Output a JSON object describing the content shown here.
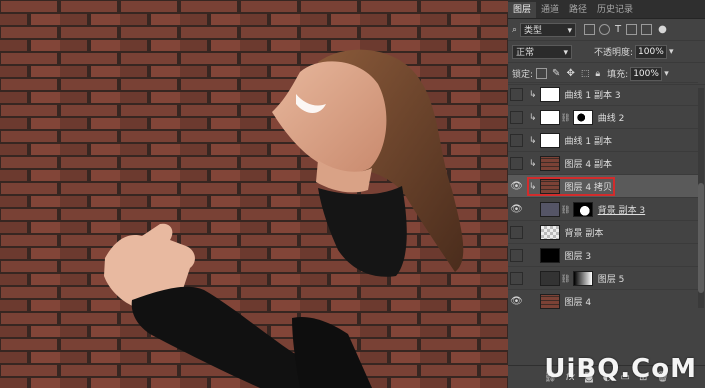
{
  "panel": {
    "tabs": [
      "图层",
      "通道",
      "路径",
      "历史记录"
    ],
    "active_tab": 0,
    "filter_select": "类型",
    "blend_mode": "正常",
    "opacity_label": "不透明度:",
    "opacity_value": "100%",
    "lock_label": "锁定:",
    "fill_label": "填充:",
    "fill_value": "100%",
    "layers": [
      {
        "name": "曲线 1 副本 3",
        "visible": false,
        "clipped": true,
        "thumb": "checker-white"
      },
      {
        "name": "曲线 2",
        "visible": false,
        "clipped": true,
        "thumb": "adjust-mask"
      },
      {
        "name": "曲线 1 副本",
        "visible": false,
        "clipped": true,
        "thumb": "checker-white"
      },
      {
        "name": "图层 4 副本",
        "visible": false,
        "clipped": true,
        "thumb": "brick"
      },
      {
        "name": "图层 4 拷贝",
        "visible": true,
        "clipped": true,
        "thumb": "brick",
        "selected": true
      },
      {
        "name": "背景 副本 3",
        "visible": true,
        "clipped": false,
        "thumb": "photo-mask"
      },
      {
        "name": "背景 副本",
        "visible": false,
        "clipped": false,
        "thumb": "checker"
      },
      {
        "name": "图层 3",
        "visible": false,
        "clipped": false,
        "thumb": "black"
      },
      {
        "name": "图层 5",
        "visible": false,
        "clipped": false,
        "thumb": "photo-gradient"
      },
      {
        "name": "图层 4",
        "visible": true,
        "clipped": false,
        "thumb": "brick"
      }
    ],
    "bottom_icons": [
      "link-icon",
      "fx-icon",
      "mask-icon",
      "adjustment-icon",
      "folder-icon",
      "new-layer-icon",
      "trash-icon"
    ]
  },
  "colors": {
    "panel_bg": "#434343",
    "selection_outline": "#d22c2c",
    "brick": "#8a4b3d"
  },
  "watermark": "UiBQ.CoM"
}
